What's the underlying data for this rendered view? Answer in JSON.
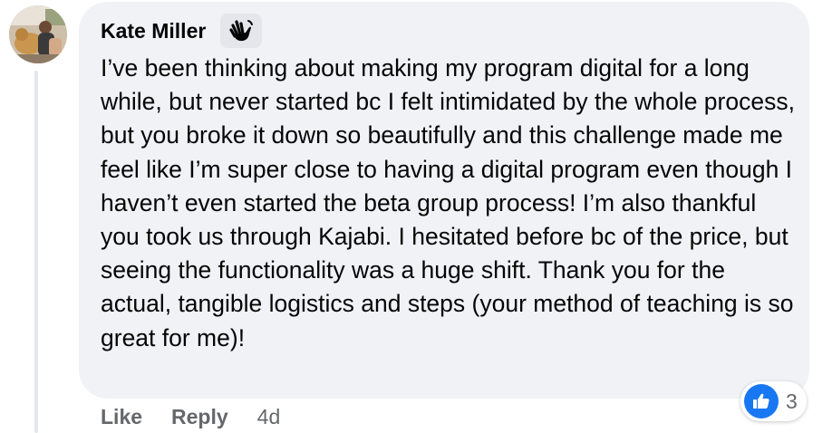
{
  "comment": {
    "author": "Kate Miller",
    "badge_icon": "waving-hand-icon",
    "text": "I’ve been thinking about making my program digital for a long while, but never started bc I felt intimidated by the whole process, but you broke it down so beautifully and this challenge made me feel like I’m super close to having a digital program even though I haven’t even started the beta group process! I’m also thankful you took us through Kajabi. I hesitated before bc of the price, but seeing the functionality was a huge shift. Thank you for the actual, tangible logistics and steps (your method of teaching is so great for me)!",
    "reaction_icon": "thumbs-up-icon",
    "reaction_count": "3"
  },
  "actions": {
    "like_label": "Like",
    "reply_label": "Reply",
    "timestamp": "4d"
  },
  "colors": {
    "bubble": "#f0f2f5",
    "text": "#050505",
    "secondary_text": "#65676b",
    "like_blue": "#1877f2"
  }
}
